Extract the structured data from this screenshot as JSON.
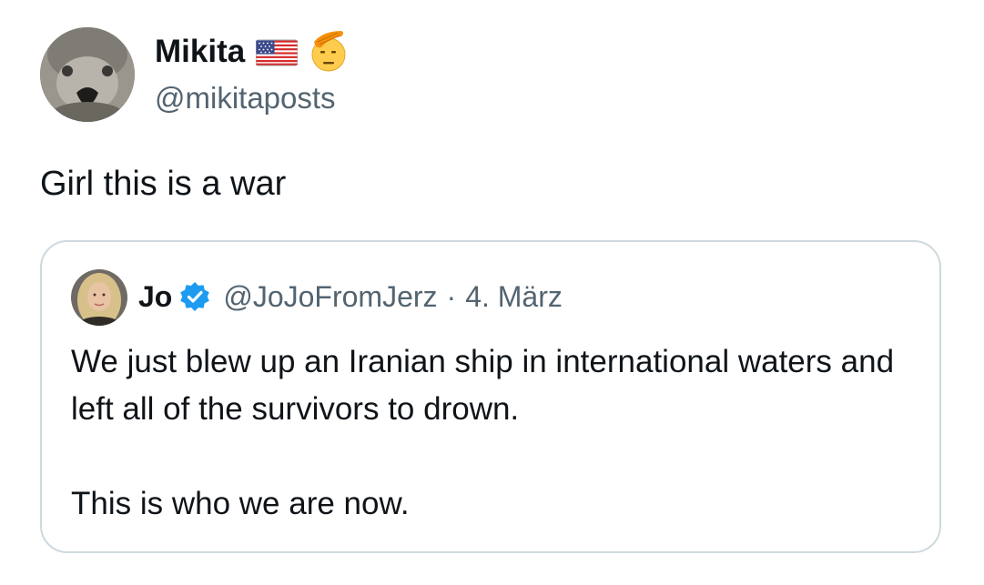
{
  "author": {
    "display_name": "Mikita",
    "handle": "@mikitaposts",
    "name_emojis": [
      "us-flag-icon",
      "saluting-face-icon"
    ]
  },
  "tweet": {
    "text": "Girl this is a war"
  },
  "quoted_tweet": {
    "display_name": "Jo",
    "verified": true,
    "handle": "@JoJoFromJerz",
    "separator": "·",
    "date": "4. März",
    "paragraph_1": "We just blew up an Iranian ship in international waters and left all of the survivors to drown.",
    "paragraph_2": "This is who we are now."
  },
  "colors": {
    "text_primary": "#0f1419",
    "text_secondary": "#536471",
    "border": "#cfd9de",
    "verified_blue": "#1d9bf0"
  }
}
